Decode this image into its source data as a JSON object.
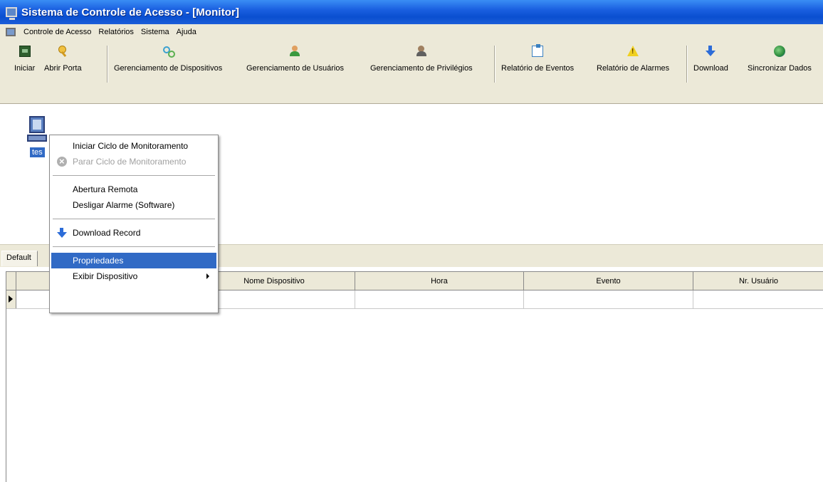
{
  "window": {
    "title": "Sistema de Controle de Acesso - [Monitor]"
  },
  "menubar": {
    "items": [
      "Controle de Acesso",
      "Relatórios",
      "Sistema",
      "Ajuda"
    ]
  },
  "toolbar": {
    "buttons": [
      {
        "label": "Iniciar",
        "icon": "monitor-icon"
      },
      {
        "label": "Abrir Porta",
        "icon": "key-icon"
      },
      {
        "label": "Gerenciamento de Dispositivos",
        "icon": "devices-icon"
      },
      {
        "label": "Gerenciamento de Usuários",
        "icon": "users-icon"
      },
      {
        "label": "Gerenciamento de Privilégios",
        "icon": "privileges-icon"
      },
      {
        "label": "Relatório de Eventos",
        "icon": "event-report-icon"
      },
      {
        "label": "Relatório de Alarmes",
        "icon": "alarm-warning-icon"
      },
      {
        "label": "Download",
        "icon": "download-arrow-icon"
      },
      {
        "label": "Sincronizar Dados",
        "icon": "globe-sync-icon"
      }
    ]
  },
  "device": {
    "label": "tes"
  },
  "context_menu": {
    "items": [
      {
        "label": "Iniciar Ciclo de Monitoramento"
      },
      {
        "label": "Parar Ciclo de Monitoramento",
        "disabled": true
      },
      {
        "label": "Abertura Remota"
      },
      {
        "label": "Desligar Alarme (Software)"
      },
      {
        "label": "Download Record"
      },
      {
        "label": "Propriedades",
        "selected": true
      },
      {
        "label": "Exibir Dispositivo",
        "submenu": true
      }
    ]
  },
  "tabs": {
    "default": "Default"
  },
  "grid": {
    "columns": [
      "",
      "Nome Dispositivo",
      "Hora",
      "Evento",
      "Nr. Usuário"
    ]
  },
  "colors": {
    "titlebar": "#0a4fd0",
    "chrome": "#ece9d8",
    "selection": "#316ac5"
  }
}
